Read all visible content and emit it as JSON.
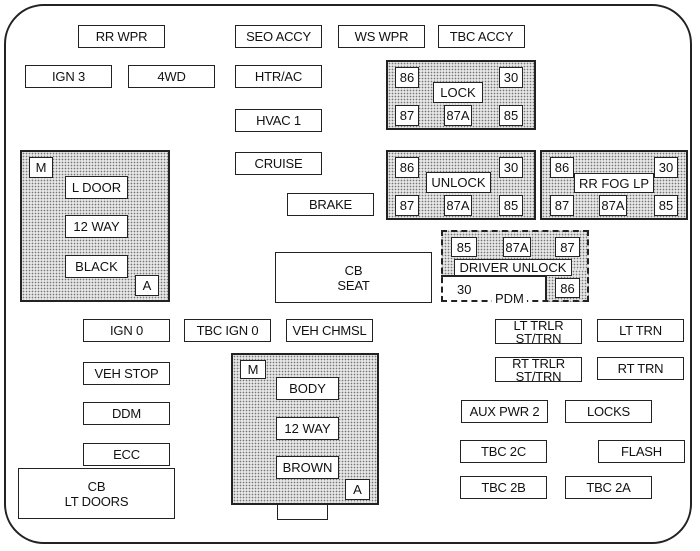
{
  "diagram": {
    "type": "fuse-panel",
    "fuses": {
      "rr_wpr": "RR WPR",
      "seo_accy": "SEO ACCY",
      "ws_wpr": "WS WPR",
      "tbc_accy": "TBC ACCY",
      "ign3": "IGN 3",
      "fwd": "4WD",
      "htr_ac": "HTR/AC",
      "hvac1": "HVAC 1",
      "cruise": "CRUISE",
      "brake": "BRAKE",
      "ign0": "IGN 0",
      "tbc_ign0": "TBC IGN 0",
      "veh_chmsl": "VEH CHMSL",
      "veh_stop": "VEH STOP",
      "ddm": "DDM",
      "ecc": "ECC",
      "lt_trlr": "LT TRLR\nST/TRN",
      "lt_trn": "LT TRN",
      "rt_trlr": "RT TRLR\nST/TRN",
      "rt_trn": "RT TRN",
      "aux_pwr2": "AUX PWR 2",
      "locks": "LOCKS",
      "tbc2c": "TBC 2C",
      "flash": "FLASH",
      "tbc2b": "TBC 2B",
      "tbc2a": "TBC 2A"
    },
    "circuit_breakers": {
      "cb_seat": "CB\nSEAT",
      "cb_lt_doors": "CB\nLT DOORS"
    },
    "relays": {
      "lock": {
        "label": "LOCK",
        "pins": [
          "86",
          "30",
          "87",
          "87A",
          "85"
        ]
      },
      "unlock": {
        "label": "UNLOCK",
        "pins": [
          "86",
          "30",
          "87",
          "87A",
          "85"
        ]
      },
      "rr_fog_lp": {
        "label": "RR FOG LP",
        "pins": [
          "86",
          "30",
          "87",
          "87A",
          "85"
        ]
      },
      "driver_unlock": {
        "label": "DRIVER UNLOCK",
        "pins": [
          "85",
          "87A",
          "87",
          "86"
        ],
        "pin30": "30",
        "module": "PDM"
      }
    },
    "connectors": {
      "left": {
        "top_tag": "M",
        "labels": [
          "L DOOR",
          "12 WAY",
          "BLACK"
        ],
        "bottom_tag": "A"
      },
      "center": {
        "top_tag": "M",
        "labels": [
          "BODY",
          "12 WAY",
          "BROWN"
        ],
        "bottom_tag": "A"
      }
    }
  }
}
